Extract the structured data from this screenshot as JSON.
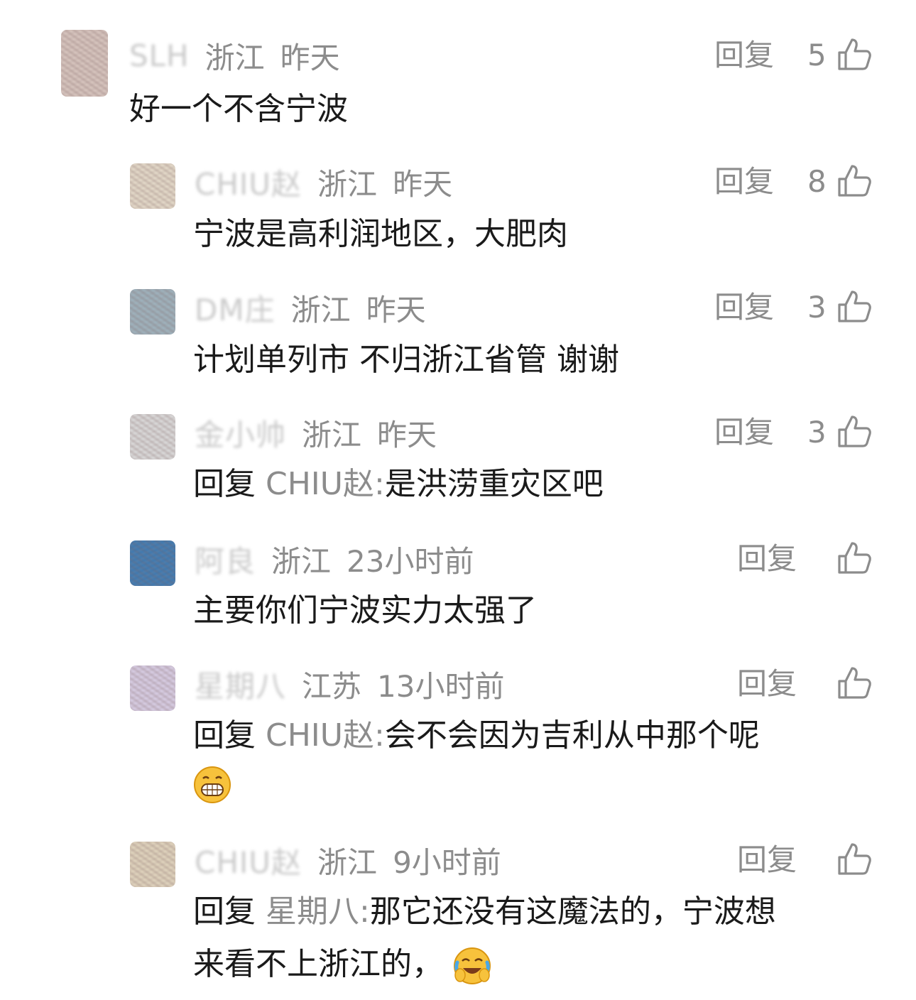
{
  "comments": [
    {
      "username": "SLH",
      "region": "浙江",
      "time": "昨天",
      "likes": "5",
      "text": "好一个不含宁波",
      "reply_label": "回复"
    },
    {
      "username": "CHIU赵",
      "region": "浙江",
      "time": "昨天",
      "likes": "8",
      "text": "宁波是高利润地区，大肥肉",
      "reply_label": "回复"
    },
    {
      "username": "DM庄",
      "region": "浙江",
      "time": "昨天",
      "likes": "3",
      "text": "计划单列市 不归浙江省管 谢谢",
      "reply_label": "回复"
    },
    {
      "username": "金小帅",
      "region": "浙江",
      "time": "昨天",
      "likes": "3",
      "reply_prefix": "回复",
      "mention": "CHIU赵:",
      "text": "是洪涝重灾区吧",
      "reply_label": "回复"
    },
    {
      "username": "阿良",
      "region": "浙江",
      "time": "23小时前",
      "likes": "",
      "text": "主要你们宁波实力太强了",
      "reply_label": "回复"
    },
    {
      "username": "星期八",
      "region": "江苏",
      "time": "13小时前",
      "likes": "",
      "reply_prefix": "回复",
      "mention": "CHIU赵:",
      "text": "会不会因为吉利从中那个呢",
      "emoji": "grinning-emoji",
      "reply_label": "回复"
    },
    {
      "username": "CHIU赵",
      "region": "浙江",
      "time": "9小时前",
      "likes": "",
      "reply_prefix": "回复",
      "mention": "星期八:",
      "text": "那它还没有这魔法的，宁波想",
      "text2": "来看不上浙江的，",
      "emoji": "laugh-cry-emoji",
      "reply_label": "回复"
    }
  ]
}
